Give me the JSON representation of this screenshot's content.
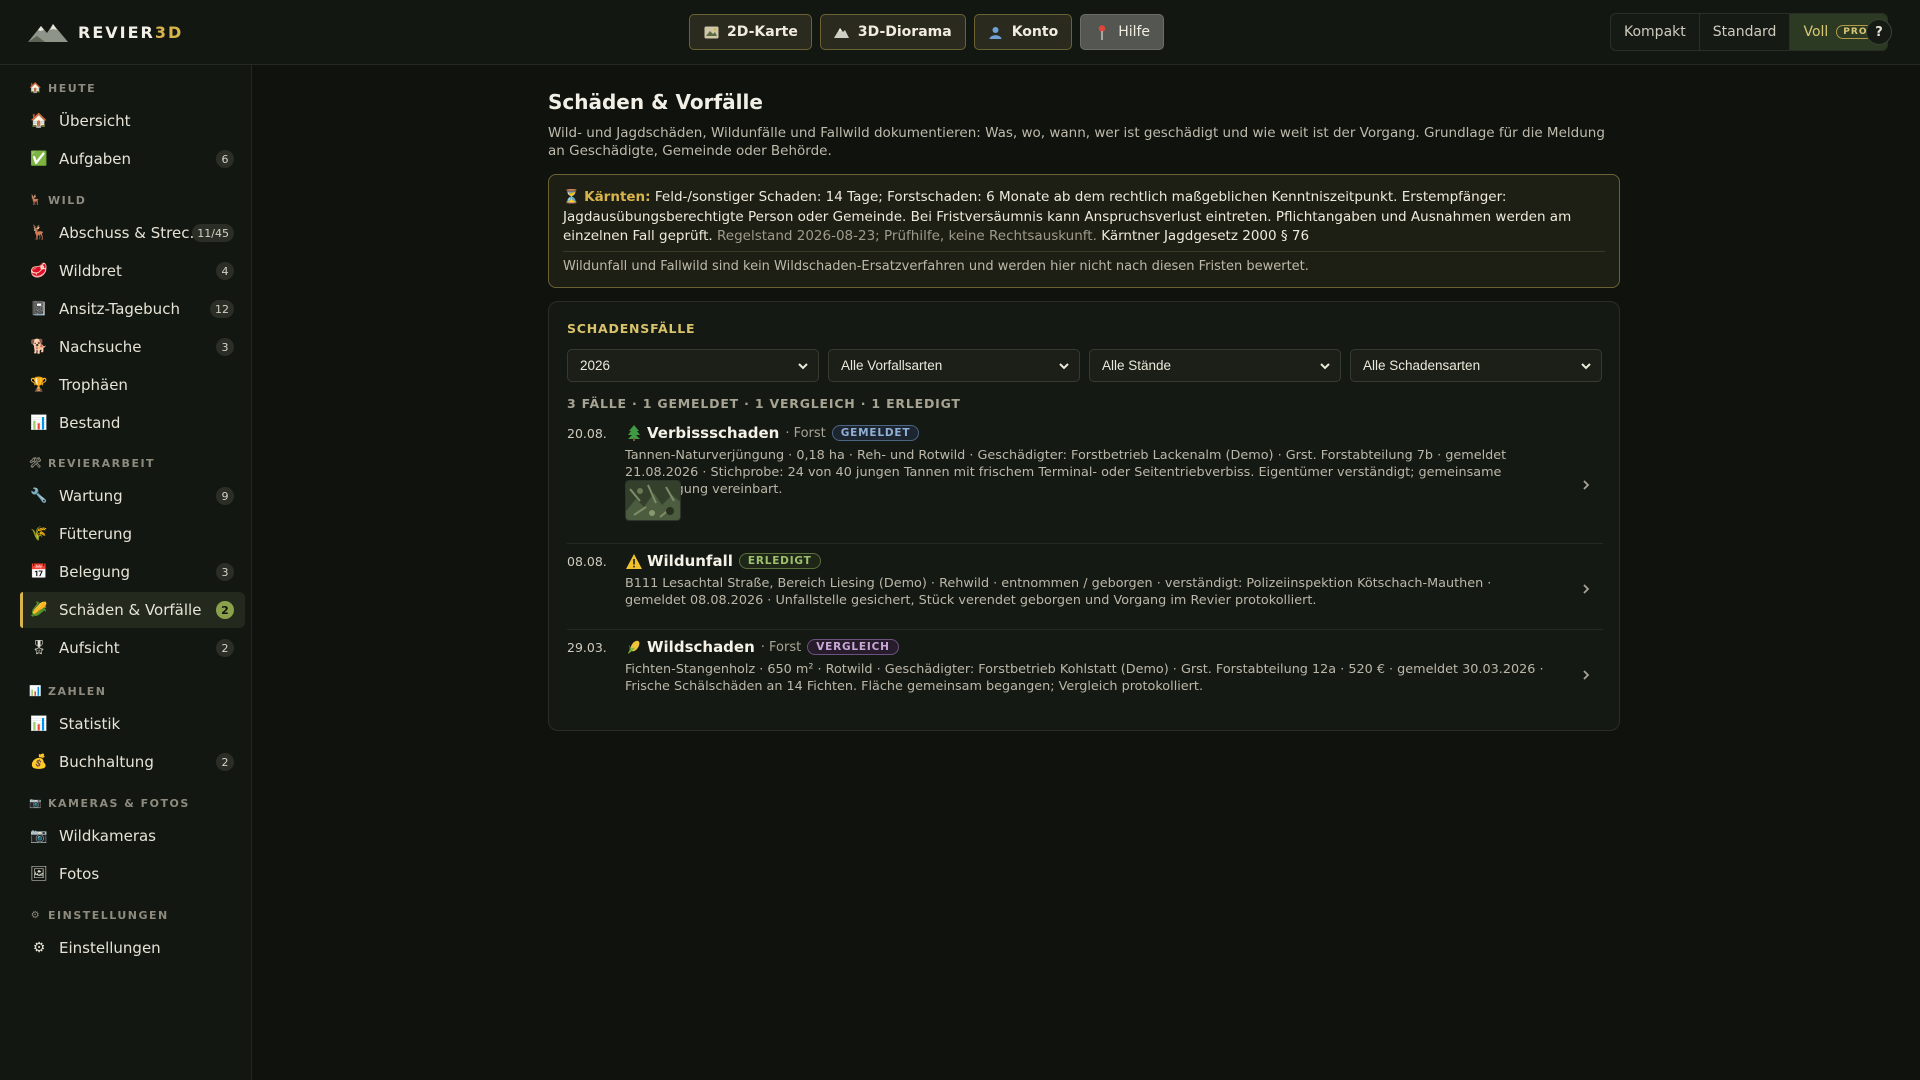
{
  "app": {
    "brand_main": "REVIER",
    "brand_accent": "3D",
    "accent_color": "#d8b54c"
  },
  "topnav": [
    {
      "label": "2D-Karte",
      "icon": "map-icon"
    },
    {
      "label": "3D-Diorama",
      "icon": "mountain-icon"
    },
    {
      "label": "Konto",
      "icon": "user-icon"
    },
    {
      "label": "Hilfe",
      "icon": "pin-icon"
    }
  ],
  "density": {
    "options": [
      "Kompakt",
      "Standard",
      "Voll"
    ],
    "active": "Voll",
    "pro_badge": "PRO"
  },
  "help_label": "?",
  "sidebar": {
    "sections": [
      {
        "title": "HEUTE",
        "icon": "house-icon",
        "items": [
          {
            "label": "Übersicht",
            "icon": "house-icon",
            "badge": ""
          },
          {
            "label": "Aufgaben",
            "icon": "check-icon",
            "badge": "6"
          }
        ]
      },
      {
        "title": "WILD",
        "icon": "deer-icon",
        "items": [
          {
            "label": "Abschuss & Strec…",
            "icon": "deer-icon",
            "badge": "11/45"
          },
          {
            "label": "Wildbret",
            "icon": "meat-icon",
            "badge": "4"
          },
          {
            "label": "Ansitz-Tagebuch",
            "icon": "notebook-icon",
            "badge": "12"
          },
          {
            "label": "Nachsuche",
            "icon": "dog-icon",
            "badge": "3"
          },
          {
            "label": "Trophäen",
            "icon": "trophy-icon",
            "badge": ""
          },
          {
            "label": "Bestand",
            "icon": "chart-icon",
            "badge": ""
          }
        ]
      },
      {
        "title": "REVIERARBEIT",
        "icon": "tools-icon",
        "items": [
          {
            "label": "Wartung",
            "icon": "wrench-icon",
            "badge": "9"
          },
          {
            "label": "Fütterung",
            "icon": "wheat-icon",
            "badge": ""
          },
          {
            "label": "Belegung",
            "icon": "calendar-icon",
            "badge": "3"
          },
          {
            "label": "Schäden & Vorfälle",
            "icon": "corn-icon",
            "badge": "2",
            "active": true
          },
          {
            "label": "Aufsicht",
            "icon": "badge-icon",
            "badge": "2"
          }
        ]
      },
      {
        "title": "ZAHLEN",
        "icon": "chart-icon",
        "items": [
          {
            "label": "Statistik",
            "icon": "chart-icon",
            "badge": ""
          },
          {
            "label": "Buchhaltung",
            "icon": "moneybag-icon",
            "badge": "2"
          }
        ]
      },
      {
        "title": "KAMERAS & FOTOS",
        "icon": "camera-icon",
        "items": [
          {
            "label": "Wildkameras",
            "icon": "camera-icon",
            "badge": ""
          },
          {
            "label": "Fotos",
            "icon": "image-icon",
            "badge": ""
          }
        ]
      },
      {
        "title": "EINSTELLUNGEN",
        "icon": "gear-icon",
        "items": [
          {
            "label": "Einstellungen",
            "icon": "gear-icon",
            "badge": ""
          }
        ]
      }
    ]
  },
  "page": {
    "title": "Schäden & Vorfälle",
    "subtitle": "Wild- und Jagdschäden, Wildunfälle und Fallwild dokumentieren: Was, wo, wann, wer ist geschädigt und wie weit ist der Vorgang. Grundlage für die Meldung an Geschädigte, Gemeinde oder Behörde."
  },
  "notice": {
    "region": "Kärnten:",
    "text": " Feld-/sonstiger Schaden: 14 Tage; Forstschaden: 6 Monate ab dem rechtlich maßgeblichen Kenntniszeitpunkt. Erstempfänger: Jagdausübungsberechtigte Person oder Gemeinde. Bei Fristversäumnis kann Anspruchsverlust eintreten. Pflichtangaben und Ausnahmen werden am einzelnen Fall geprüft.",
    "meta": " Regelstand 2026-08-23; Prüfhilfe, keine Rechtsauskunft.",
    "law": " Kärntner Jagdgesetz 2000 § 76",
    "footnote": "Wildunfall und Fallwild sind kein Wildschaden-Ersatzverfahren und werden hier nicht nach diesen Fristen bewertet."
  },
  "cases": {
    "title": "SCHADENSFÄLLE",
    "filters": [
      "2026",
      "Alle Vorfallsarten",
      "Alle Stände",
      "Alle Schadensarten"
    ],
    "summary": "3 FÄLLE · 1 GEMELDET · 1 VERGLEICH · 1 ERLEDIGT",
    "items": [
      {
        "date": "20.08.",
        "icon": "tree-icon",
        "title": "Verbissschaden",
        "category": "· Forst",
        "status": "GEMELDET",
        "desc": "Tannen-Naturverjüngung · 0,18 ha · Reh- und Rotwild · Geschädigter: Forstbetrieb Lackenalm (Demo) · Grst. Forstabteilung 7b · gemeldet 21.08.2026 · Stichprobe: 24 von 40 jungen Tannen mit frischem Terminal- oder Seitentriebverbiss. Eigentümer verständigt; gemeinsame Besichtigung vereinbart."
      },
      {
        "date": "08.08.",
        "icon": "warning-icon",
        "title": "Wildunfall",
        "category": "",
        "status": "ERLEDIGT",
        "desc": "B111 Lesachtal Straße, Bereich Liesing (Demo) · Rehwild · entnommen / geborgen · verständigt: Polizeiinspektion Kötschach-Mauthen · gemeldet 08.08.2026 · Unfallstelle gesichert, Stück verendet geborgen und Vorgang im Revier protokolliert."
      },
      {
        "date": "29.03.",
        "icon": "corn-icon",
        "title": "Wildschaden",
        "category": "· Forst",
        "status": "VERGLEICH",
        "desc": "Fichten-Stangenholz · 650 m² · Rotwild · Geschädigter: Forstbetrieb Kohlstatt (Demo) · Grst. Forstabteilung 12a · 520 € · gemeldet 30.03.2026 · Frische Schälschäden an 14 Fichten. Fläche gemeinsam begangen; Vergleich protokolliert."
      }
    ]
  }
}
